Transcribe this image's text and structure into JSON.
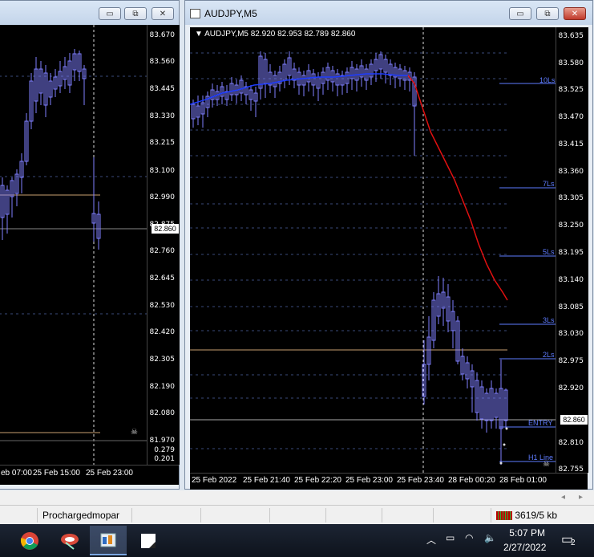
{
  "left_window": {
    "buttons": {
      "minimize": "▭",
      "maximize": "⧉",
      "close": "✕"
    },
    "yticks": [
      "83.670",
      "83.560",
      "83.445",
      "83.330",
      "83.215",
      "83.100",
      "82.990",
      "82.875",
      "82.760",
      "82.645",
      "82.530",
      "82.420",
      "82.305",
      "82.190",
      "82.080",
      "81.970"
    ],
    "price_badge": "82.860",
    "indicator_ticks": [
      "0.279",
      "0.201"
    ],
    "xticks": [
      "eb 07:00",
      "25 Feb 15:00",
      "25 Feb 23:00"
    ]
  },
  "right_window": {
    "title": "AUDJPY,M5",
    "chart_title": "▼ AUDJPY,M5  82.920 82.953 82.789 82.860",
    "buttons": {
      "minimize": "▭",
      "maximize": "⧉",
      "close": "✕"
    },
    "yticks": [
      "83.635",
      "83.580",
      "83.525",
      "83.470",
      "83.415",
      "83.360",
      "83.305",
      "83.250",
      "83.195",
      "83.140",
      "83.085",
      "83.030",
      "82.975",
      "82.920",
      "82.865",
      "82.810",
      "82.755"
    ],
    "price_badge": "82.860",
    "levels": [
      "10Ls",
      "7Ls",
      "5Ls",
      "3Ls",
      "2Ls",
      "ENTRY",
      "H1 Line"
    ],
    "xticks": [
      "25 Feb 2022",
      "25 Feb 21:40",
      "25 Feb 22:20",
      "25 Feb 23:00",
      "25 Feb 23:40",
      "28 Feb 00:20",
      "28 Feb 01:00"
    ]
  },
  "statusbar": {
    "profile": "Prochargedmopar",
    "traffic": "3619/5 kb"
  },
  "taskbar": {
    "time": "5:07 PM",
    "date": "2/27/2022",
    "notifications": "2"
  },
  "colors": {
    "chart_bg": "#000000",
    "candle": "#7f7fff",
    "ma_blue": "#1e3cff",
    "ma_red": "#e01010",
    "grid": "#3a4a7a",
    "h_line": "#c8a070"
  }
}
